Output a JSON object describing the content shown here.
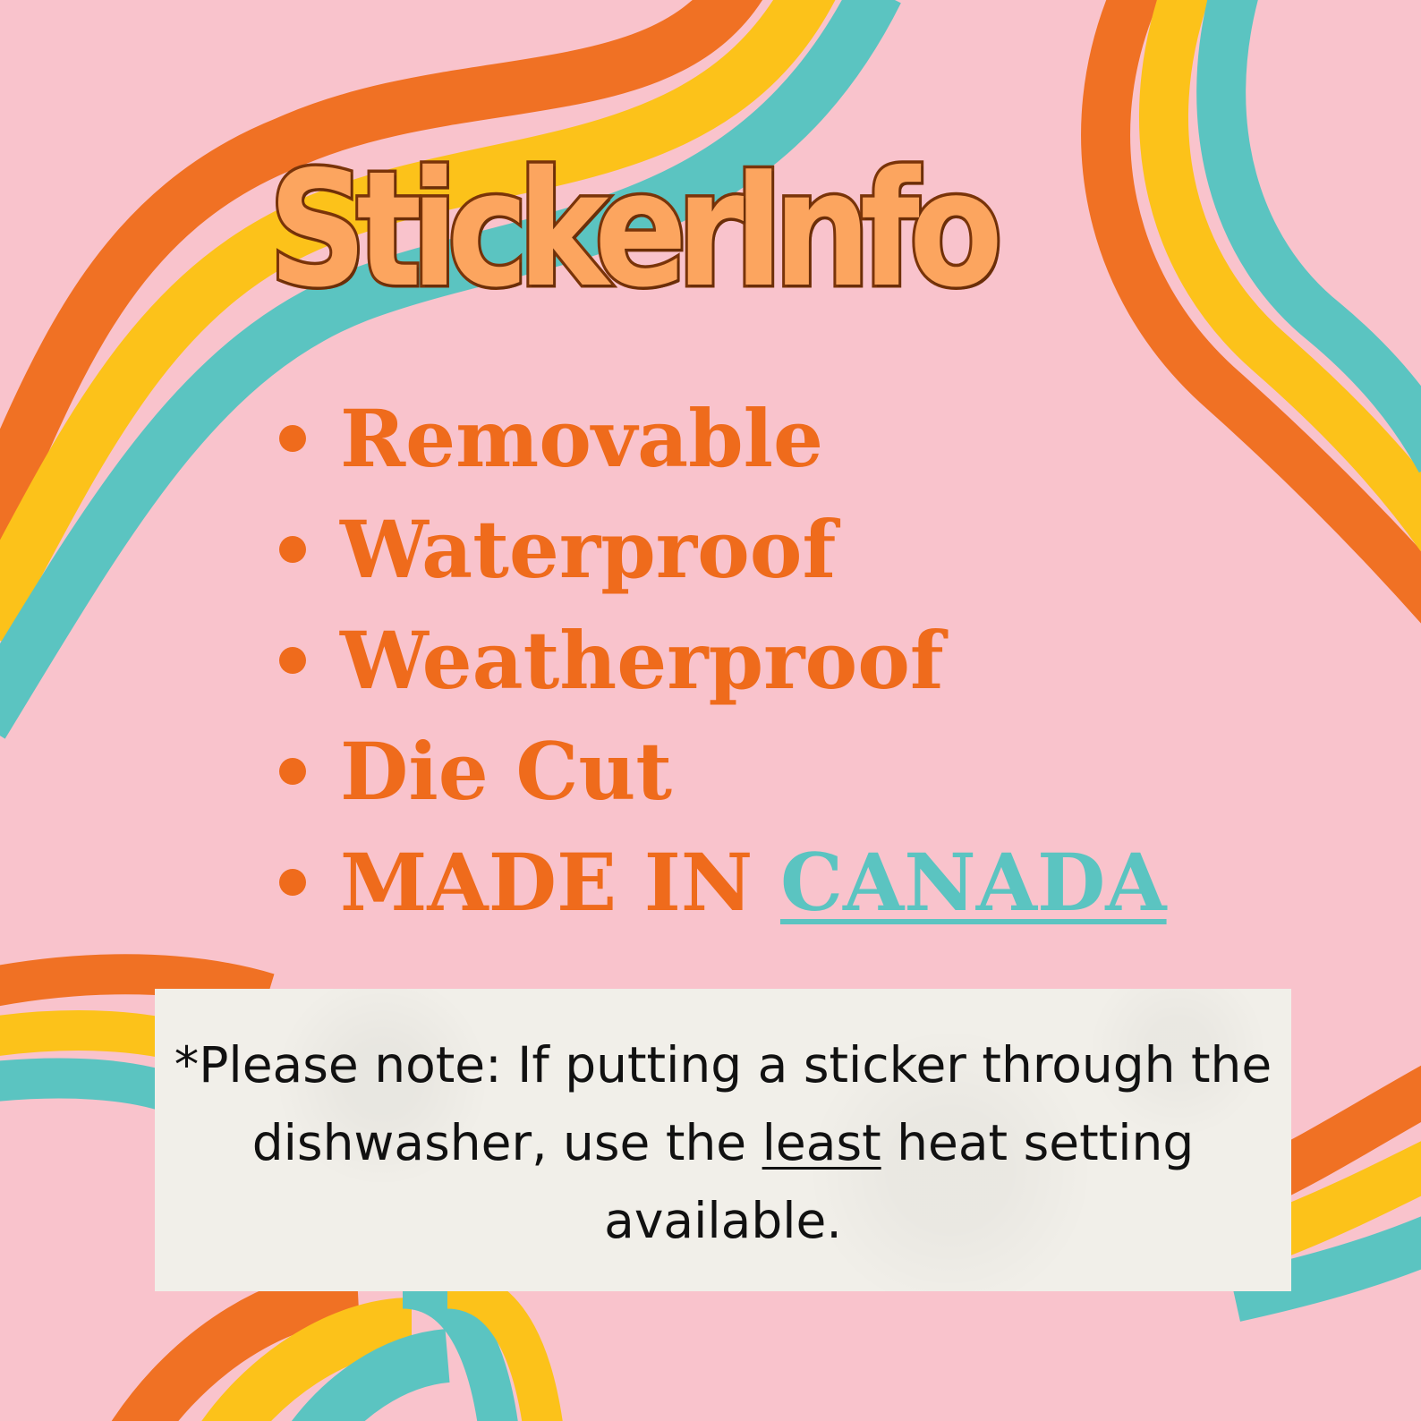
{
  "title": "StickerInfo",
  "features": [
    "Removable",
    "Waterproof",
    "Weatherproof",
    "Die Cut"
  ],
  "made_in": {
    "prefix": "MADE IN",
    "country": "CANADA"
  },
  "note": {
    "before": "*Please note: If putting a sticker through the dishwasher, use the",
    "underlined": "least",
    "after": "heat setting available."
  },
  "colors": {
    "background": "#f9c3cc",
    "orange": "#f07124",
    "yellow": "#fcc21a",
    "teal": "#5bc4c1",
    "title_fill": "#fca55f",
    "title_outline": "#7a3409",
    "feature_text": "#ef6b1c",
    "note_box": "#f1efe9",
    "note_text": "#111111"
  }
}
